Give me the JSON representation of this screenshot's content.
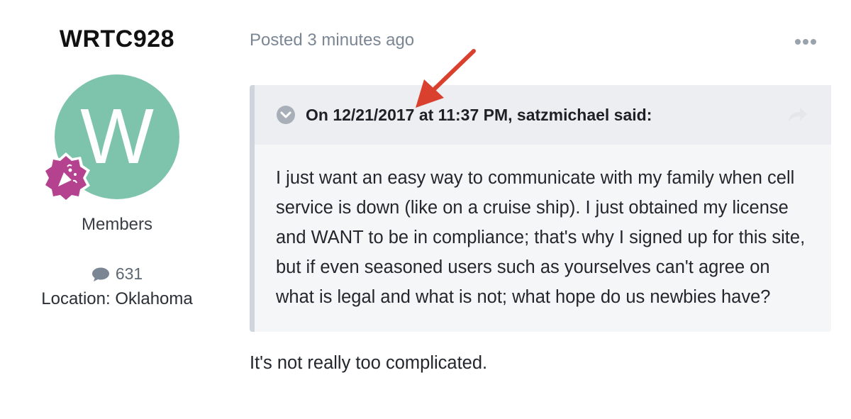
{
  "author": {
    "username": "WRTC928",
    "avatar_letter": "W",
    "avatar_color": "#7ec4ad",
    "badge_icon": "party-popper-icon",
    "badge_color": "#b5428f",
    "group": "Members",
    "post_count": "631",
    "location": "Location: Oklahoma"
  },
  "post": {
    "posted_label": "Posted 3 minutes ago",
    "more_icon": "ellipsis-icon",
    "quote": {
      "citation": "On 12/21/2017 at 11:37 PM, satzmichael said:",
      "body": "I just want an easy way to communicate with my family when cell service is down (like on a cruise ship). I just obtained my license and WANT to be in compliance; that's why I signed up for this site, but if even seasoned users such as yourselves can't agree on what is legal and what is not; what hope do us newbies have?"
    },
    "reply": "It's not really too complicated."
  },
  "annotation": {
    "arrow_color": "#d9412e"
  }
}
